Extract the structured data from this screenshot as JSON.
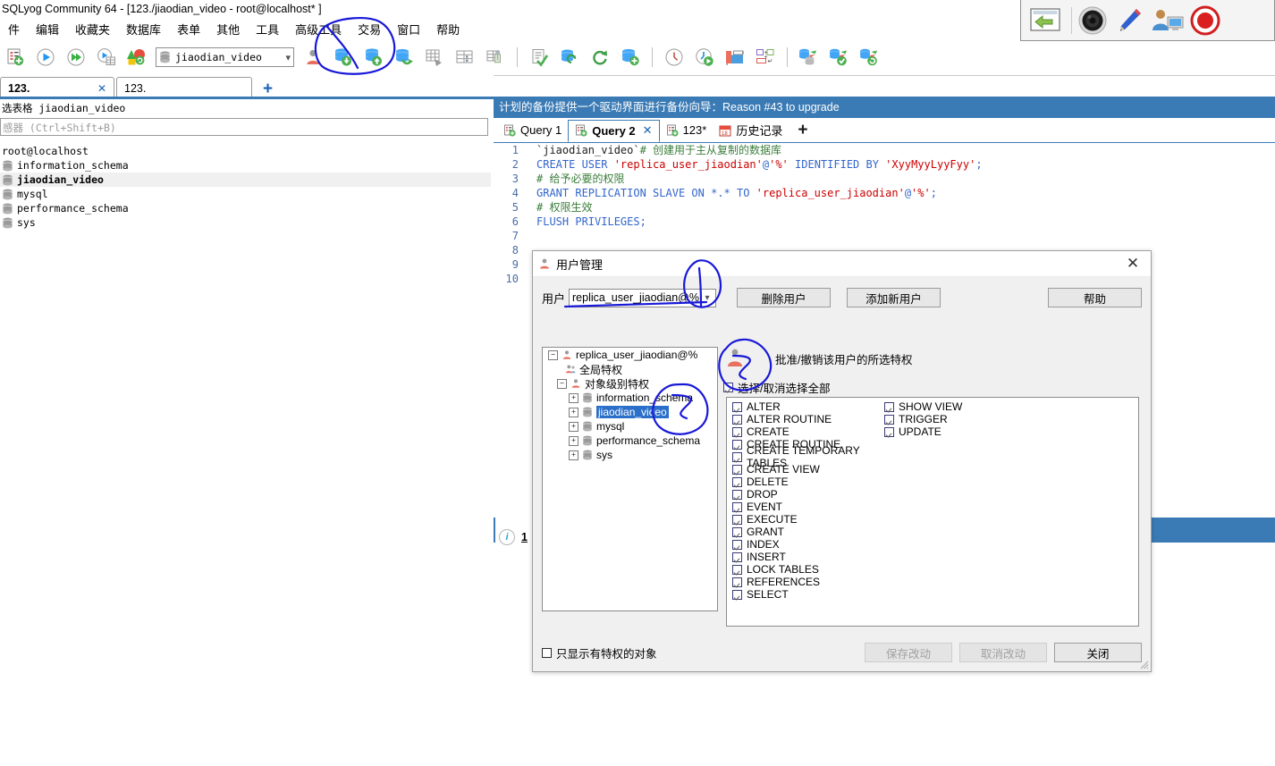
{
  "window": {
    "title": "SQLyog Community 64 - [123./jiaodian_video - root@localhost* ]"
  },
  "menubar": {
    "items": [
      "件",
      "编辑",
      "收藏夹",
      "数据库",
      "表单",
      "其他",
      "工具",
      "高级工具",
      "交易",
      "窗口",
      "帮助"
    ]
  },
  "toolbar": {
    "database_combo_value": "jiaodian_video",
    "icons": [
      "new-query-icon",
      "execute-query-icon",
      "execute-all-icon",
      "execute-to-grid-icon",
      "refresh-objects-icon",
      "user-manager-icon",
      "import-data-icon",
      "export-data-icon",
      "backup-database-icon",
      "restore-database-icon",
      "table-diagnostics-icon",
      "table-data-icon",
      "manage-indexes-icon",
      "query-builder-icon",
      "sync-database-icon",
      "refresh-icon",
      "schema-sync-icon",
      "scheduled-backup-icon",
      "scheduled-job-icon",
      "form-view-icon",
      "copy-database-icon",
      "data-sync-icon",
      "data-compare-icon",
      "restore-point-icon"
    ]
  },
  "connection_tabs": {
    "tabs": [
      {
        "label": "123.",
        "active": true,
        "closable": true
      },
      {
        "label": "123.",
        "active": false,
        "closable": false
      }
    ],
    "add_label": "+"
  },
  "left_pane": {
    "header": "选表格 jiaodian_video",
    "search_placeholder": "感器 (Ctrl+Shift+B)",
    "root": "root@localhost",
    "databases": [
      {
        "name": "information_schema",
        "selected": false
      },
      {
        "name": "jiaodian_video",
        "selected": true
      },
      {
        "name": "mysql",
        "selected": false
      },
      {
        "name": "performance_schema",
        "selected": false
      },
      {
        "name": "sys",
        "selected": false
      }
    ]
  },
  "right_pane": {
    "promo_banner": "计划的备份提供一个驱动界面进行备份向导：Reason #43 to upgrade",
    "query_tabs": [
      {
        "label": "Query 1",
        "icon": "query-tab-icon",
        "active": false,
        "closable": false
      },
      {
        "label": "Query 2",
        "icon": "query-tab-icon",
        "active": true,
        "closable": true
      },
      {
        "label": "123*",
        "icon": "query-tab-icon",
        "active": false,
        "closable": false
      },
      {
        "label": "历史记录",
        "icon": "history-calendar-icon",
        "active": false,
        "closable": false
      }
    ],
    "add_tab_label": "+",
    "editor_lines": [
      {
        "n": "1",
        "parts": [
          {
            "t": "`jiaodian_video`",
            "c": "tick"
          },
          {
            "t": "# 创建用于主从复制的数据库",
            "c": "cmt"
          }
        ]
      },
      {
        "n": "2",
        "parts": [
          {
            "t": "CREATE USER ",
            "c": "kw"
          },
          {
            "t": "'replica_user_jiaodian'",
            "c": "str"
          },
          {
            "t": "@",
            "c": "kw"
          },
          {
            "t": "'%'",
            "c": "str"
          },
          {
            "t": " IDENTIFIED BY ",
            "c": "kw"
          },
          {
            "t": "'XyyMyyLyyFyy'",
            "c": "str"
          },
          {
            "t": ";",
            "c": "kw"
          }
        ]
      },
      {
        "n": "3",
        "parts": [
          {
            "t": "# 给予必要的权限",
            "c": "cmt"
          }
        ]
      },
      {
        "n": "4",
        "parts": [
          {
            "t": "GRANT REPLICATION SLAVE ON *.* TO ",
            "c": "kw"
          },
          {
            "t": "'replica_user_jiaodian'",
            "c": "str"
          },
          {
            "t": "@",
            "c": "kw"
          },
          {
            "t": "'%'",
            "c": "str"
          },
          {
            "t": ";",
            "c": "kw"
          }
        ]
      },
      {
        "n": "5",
        "parts": [
          {
            "t": "# 权限生效",
            "c": "cmt"
          }
        ]
      },
      {
        "n": "6",
        "parts": [
          {
            "t": "FLUSH PRIVILEGES;",
            "c": "kw"
          }
        ]
      },
      {
        "n": "7",
        "parts": []
      },
      {
        "n": "8",
        "parts": []
      },
      {
        "n": "9",
        "parts": []
      },
      {
        "n": "10",
        "parts": []
      }
    ],
    "status_count": "1"
  },
  "dialog": {
    "title": "用户管理",
    "title_icon": "user-icon",
    "close_icon": "close-icon",
    "user_label": "用户",
    "user_value": "replica_user_jiaodian@%",
    "delete_user_button": "删除用户",
    "add_user_button": "添加新用户",
    "help_button": "帮助",
    "tree": {
      "root": "replica_user_jiaodian@%",
      "global_privileges": "全局特权",
      "object_privileges": "对象级别特权",
      "databases": [
        {
          "name": "information_schema",
          "selected": false
        },
        {
          "name": "jiaodian_video",
          "selected": true
        },
        {
          "name": "mysql",
          "selected": false
        },
        {
          "name": "performance_schema",
          "selected": false
        },
        {
          "name": "sys",
          "selected": false
        }
      ]
    },
    "grant_header": "批准/撤销该用户的所选特权",
    "grant_header_icon": "user-privileges-icon",
    "select_all_label": "选择/取消选择全部",
    "select_all_checked": true,
    "privileges_col1": [
      {
        "name": "ALTER",
        "checked": true
      },
      {
        "name": "ALTER ROUTINE",
        "checked": true
      },
      {
        "name": "CREATE",
        "checked": true
      },
      {
        "name": "CREATE ROUTINE",
        "checked": true
      },
      {
        "name": "CREATE TEMPORARY TABLES",
        "checked": true
      },
      {
        "name": "CREATE VIEW",
        "checked": true
      },
      {
        "name": "DELETE",
        "checked": true
      },
      {
        "name": "DROP",
        "checked": true
      },
      {
        "name": "EVENT",
        "checked": true
      },
      {
        "name": "EXECUTE",
        "checked": true
      },
      {
        "name": "GRANT",
        "checked": true
      },
      {
        "name": "INDEX",
        "checked": true
      },
      {
        "name": "INSERT",
        "checked": true
      },
      {
        "name": "LOCK TABLES",
        "checked": true
      },
      {
        "name": "REFERENCES",
        "checked": true
      },
      {
        "name": "SELECT",
        "checked": true
      }
    ],
    "privileges_col2": [
      {
        "name": "SHOW VIEW",
        "checked": true
      },
      {
        "name": "TRIGGER",
        "checked": true
      },
      {
        "name": "UPDATE",
        "checked": true
      }
    ],
    "only_privileged_label": "只显示有特权的对象",
    "only_privileged_checked": false,
    "save_button": "保存改动",
    "cancel_button": "取消改动",
    "close_button": "关闭",
    "save_enabled": false,
    "cancel_enabled": false
  },
  "recorder": {
    "icons": [
      "screen-capture-icon",
      "webcam-icon",
      "pencil-annotate-icon",
      "presenter-icon",
      "record-button-icon"
    ]
  },
  "colors": {
    "accent_blue": "#3b7bb5",
    "ink_blue": "#1818d8",
    "selection_blue": "#2a6fc9"
  }
}
